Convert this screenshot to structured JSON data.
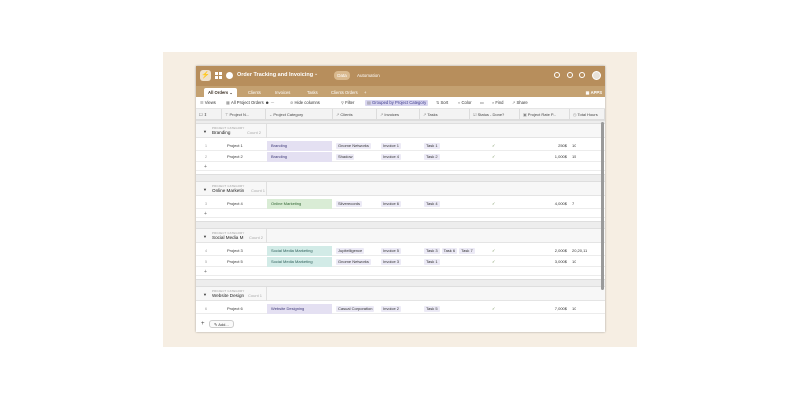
{
  "app": {
    "title": "Order Tracking and Invoicing",
    "title_chevron": "⌄",
    "logo_glyph": "⚡",
    "tabs_top": [
      "Data",
      "Automation"
    ],
    "apps_label": "APPS"
  },
  "tabs": [
    "All Orders",
    "Clients",
    "Invoices",
    "Tasks",
    "Clients Orders",
    "+"
  ],
  "toolbar": {
    "views": "Views",
    "view_name": "All Project Orders",
    "hide_columns": "Hide columns",
    "filter": "Filter",
    "grouped": "Grouped by Project Category",
    "sort": "Sort",
    "color": "Color",
    "find": "Find",
    "share": "Share"
  },
  "columns": [
    "Project N...",
    "Project Category",
    "Clients",
    "Invoices",
    "Tasks",
    "Status - Done?",
    "Project Rate P...",
    "Total Hours"
  ],
  "group_caption": "PROJECT CATEGORY",
  "groups": [
    {
      "name": "Branding",
      "count": "Count 2",
      "rows": [
        {
          "num": "1",
          "name": "Project 1",
          "category": "Branding",
          "client": "Gnome Networks",
          "invoice": "Invoice 1",
          "tasks": [
            "Task 1"
          ],
          "status": "✓",
          "rate": "250$",
          "hours": "10"
        },
        {
          "num": "2",
          "name": "Project 2",
          "category": "Branding",
          "client": "Shadow",
          "invoice": "Invoice 4",
          "tasks": [
            "Task 2"
          ],
          "status": "✓",
          "rate": "1,000$",
          "hours": "15"
        }
      ]
    },
    {
      "name": "Online Marketin",
      "count": "Count 1",
      "rows": [
        {
          "num": "3",
          "name": "Project 4",
          "category": "Online Marketing",
          "client": "Silverecords",
          "invoice": "Invoice 6",
          "tasks": [
            "Task 4"
          ],
          "status": "✓",
          "rate": "4,000$",
          "hours": "7"
        }
      ]
    },
    {
      "name": "Social Media M",
      "count": "Count 2",
      "rows": [
        {
          "num": "4",
          "name": "Project 3",
          "category": "Social Media Marketing",
          "client": "Jupitelligence",
          "invoice": "Invoice 5",
          "tasks": [
            "Task 3",
            "Task 6",
            "Task 7"
          ],
          "status": "✓",
          "rate": "2,000$",
          "hours": "20,20,11"
        },
        {
          "num": "5",
          "name": "Project 5",
          "category": "Social Media Marketing",
          "client": "Gnome Networks",
          "invoice": "Invoice 3",
          "tasks": [
            "Task 1"
          ],
          "status": "✓",
          "rate": "3,000$",
          "hours": "10"
        }
      ]
    },
    {
      "name": "Website Design",
      "count": "Count 1",
      "rows": [
        {
          "num": "6",
          "name": "Project 6",
          "category": "Website Designing",
          "client": "Casual Corporation",
          "invoice": "Invoice 2",
          "tasks": [
            "Task 5"
          ],
          "status": "✓",
          "rate": "7,000$",
          "hours": "10"
        }
      ]
    }
  ],
  "footer": {
    "plus": "+",
    "add": "Add..."
  },
  "colors": {
    "topbar": "#b78e5c",
    "tabbar": "#c4a171",
    "frame": "#f6eee3"
  }
}
